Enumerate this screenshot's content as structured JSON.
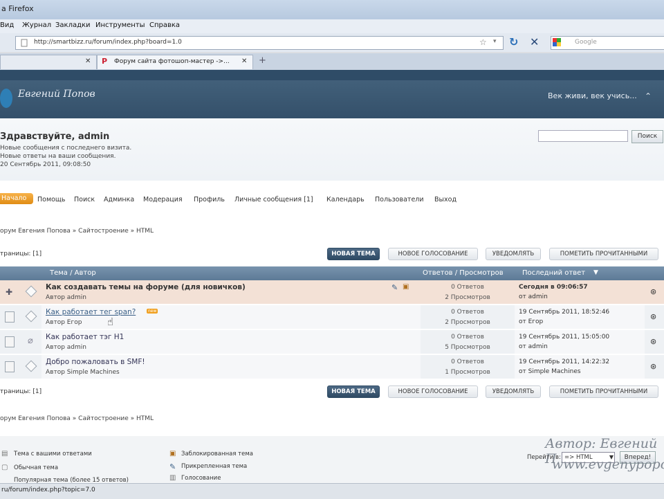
{
  "browser": {
    "title": "a Firefox",
    "menu": [
      "Вид",
      "Журнал",
      "Закладки",
      "Инструменты",
      "Справка"
    ],
    "url": "http://smartbizz.ru/forum/index.php?board=1.0",
    "search_placeholder": "Google",
    "tabs": [
      {
        "label": "",
        "close": "✕"
      },
      {
        "label": "Форум сайта фотошоп-мастер ->...",
        "close": "✕"
      }
    ],
    "new_tab": "+",
    "status": "ru/forum/index.php?topic=7.0",
    "icons": [
      "star-icon",
      "chevron-down-icon",
      "reload-icon",
      "stop-icon",
      "google-icon"
    ]
  },
  "forum": {
    "slogan": "Век живи, век учись...",
    "user": {
      "greeting": "Здравствуйте, admin",
      "lines": [
        "Новые сообщения с последнего визита.",
        "Новые ответы на ваши сообщения.",
        "20 Сентябрь 2011, 09:08:50"
      ]
    },
    "search_button": "Поиск",
    "nav": [
      {
        "label": "Начало",
        "active": true
      },
      {
        "label": "Помощь"
      },
      {
        "label": "Поиск"
      },
      {
        "label": "Админка"
      },
      {
        "label": "Модерация"
      },
      {
        "label": "Профиль"
      },
      {
        "label": "Личные сообщения [1]"
      },
      {
        "label": "Календарь"
      },
      {
        "label": "Пользователи"
      },
      {
        "label": "Выход"
      }
    ],
    "breadcrumb": "орум Евгения Попова » Сайтостроение » HTML",
    "pages": "траницы: [1]",
    "buttons": {
      "new_topic": "НОВАЯ ТЕМА",
      "new_poll": "НОВОЕ ГОЛОСОВАНИЕ",
      "notify": "УВЕДОМЛЯТЬ",
      "mark_read": "ПОМЕТИТЬ ПРОЧИТАННЫМИ"
    },
    "table": {
      "headers": {
        "subject": "Тема / Автор",
        "stats": "Ответов / Просмотров",
        "last": "Последний ответ"
      },
      "rows": [
        {
          "subject": "Как создавать темы на форуме (для новичков)",
          "author": "Автор admin",
          "replies": "0 Ответов",
          "views": "2 Просмотров",
          "last1": "Сегодня в 09:06:57",
          "last2": "от admin",
          "sticky": true
        },
        {
          "subject": "Как работает тег span?",
          "author": "Автор Егор",
          "replies": "0 Ответов",
          "views": "2 Просмотров",
          "last1": "19 Сентябрь 2011, 18:52:46",
          "last2": "от Егор",
          "new": "new"
        },
        {
          "subject": "Как работает тэг H1",
          "author": "Автор admin",
          "replies": "0 Ответов",
          "views": "5 Просмотров",
          "last1": "19 Сентябрь 2011, 15:05:00",
          "last2": "от admin"
        },
        {
          "subject": "Добро пожаловать в SMF!",
          "author": "Автор Simple Machines",
          "replies": "0 Ответов",
          "views": "1 Просмотров",
          "last1": "19 Сентябрь 2011, 14:22:32",
          "last2": "от Simple Machines"
        }
      ]
    },
    "legend": [
      "Тема с вашими ответами",
      "Обычная тема",
      "Популярная тема (более 15 ответов)",
      "Заблокированная тема",
      "Прикрепленная тема",
      "Голосование"
    ],
    "jump": {
      "label": "Перейти в:",
      "value": "=> HTML",
      "button": "Вперед!"
    },
    "watermark": [
      "Автор: Евгений П",
      "www.evgenypopov."
    ]
  }
}
